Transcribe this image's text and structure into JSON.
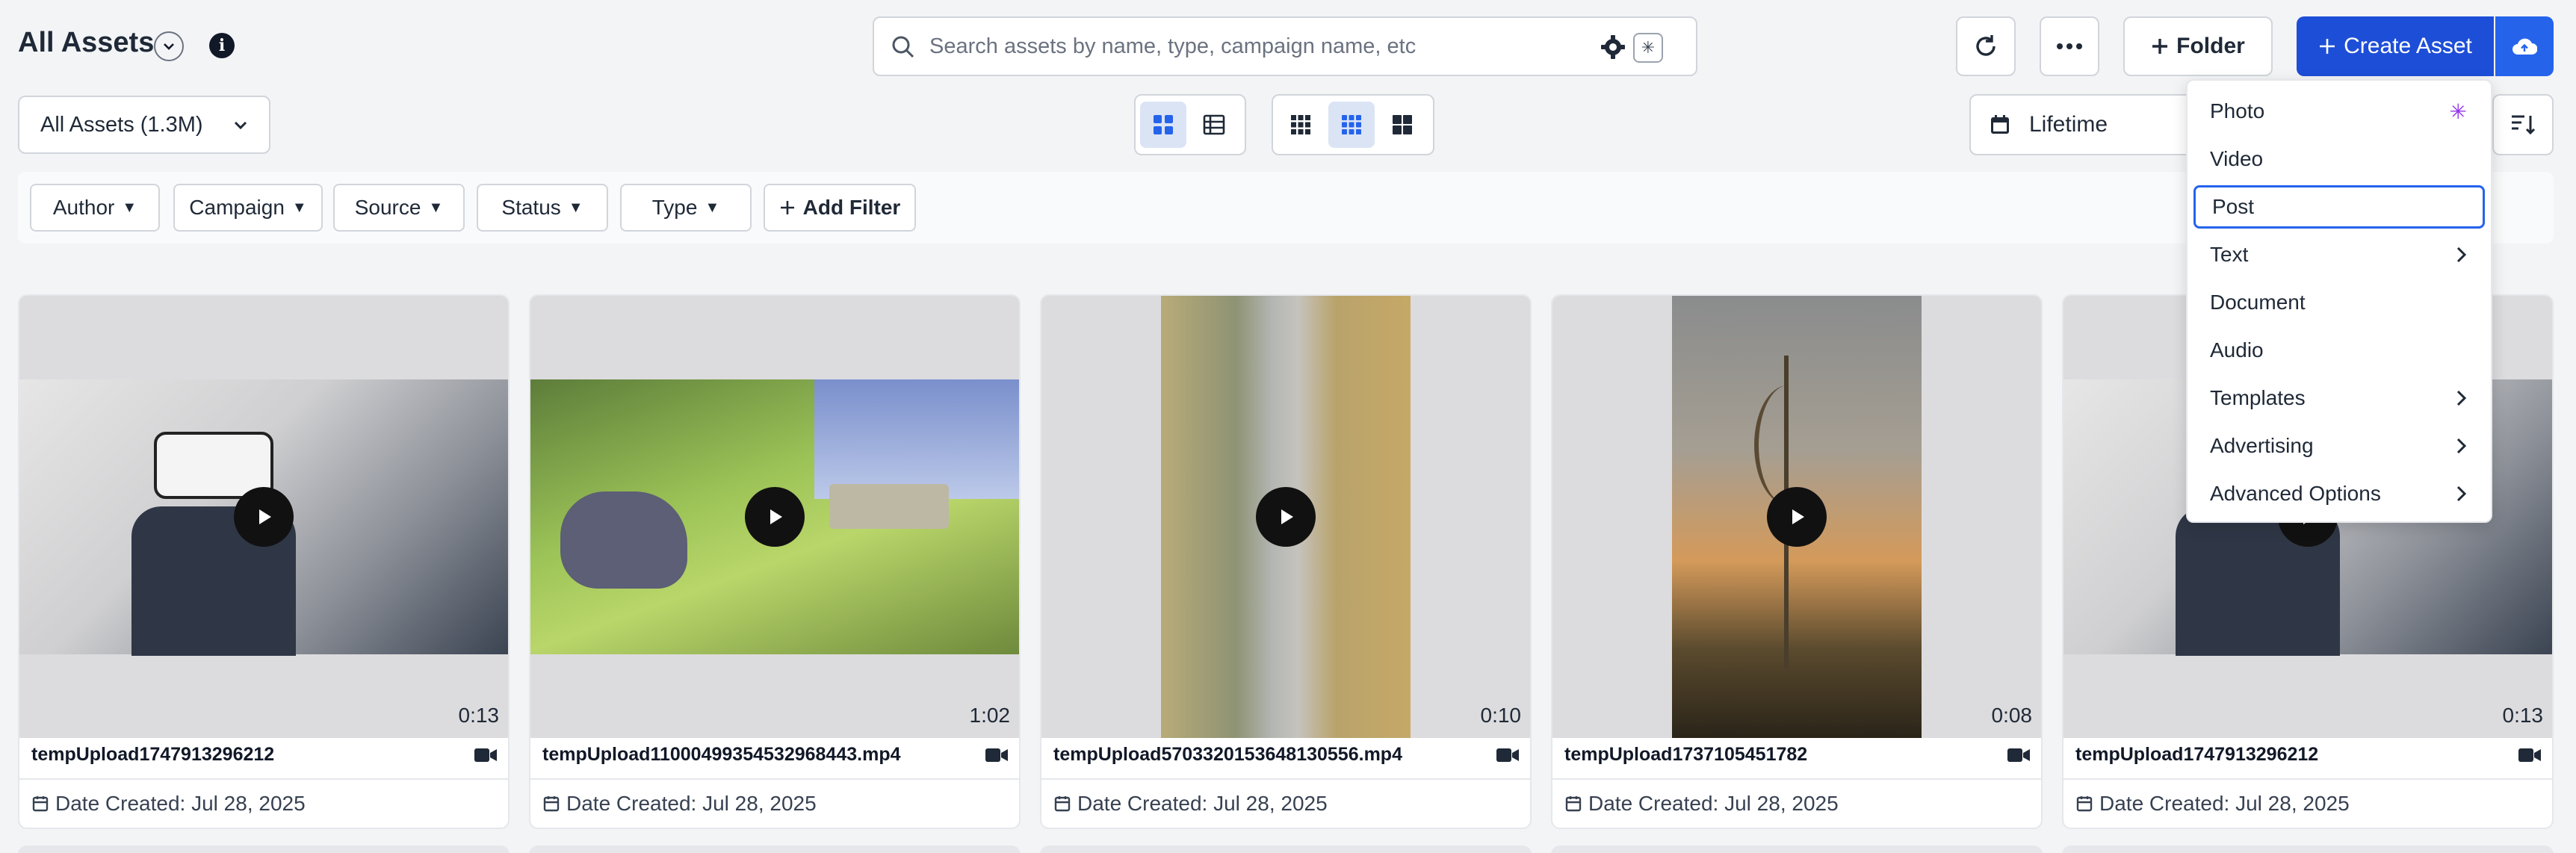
{
  "header": {
    "title": "All Assets",
    "search_placeholder": "Search assets by name, type, campaign name, etc",
    "folder_label": "Folder",
    "create_label": "Create Asset"
  },
  "toolbar": {
    "assets_dropdown": "All Assets (1.3M)",
    "date_range": "Lifetime"
  },
  "filters": [
    "Author",
    "Campaign",
    "Source",
    "Status",
    "Type"
  ],
  "add_filter_label": "Add Filter",
  "create_menu": [
    {
      "label": "Photo",
      "badge": "sparkle"
    },
    {
      "label": "Video"
    },
    {
      "label": "Post",
      "selected": true
    },
    {
      "label": "Text",
      "submenu": true
    },
    {
      "label": "Document"
    },
    {
      "label": "Audio"
    },
    {
      "label": "Templates",
      "submenu": true
    },
    {
      "label": "Advertising",
      "submenu": true
    },
    {
      "label": "Advanced Options",
      "submenu": true
    }
  ],
  "assets": [
    {
      "name": "tempUpload1747913296212",
      "duration": "0:13",
      "date": "Date Created: Jul 28, 2025",
      "type": "video"
    },
    {
      "name": "tempUpload11000499354532968443.mp4",
      "duration": "1:02",
      "date": "Date Created: Jul 28, 2025",
      "type": "video"
    },
    {
      "name": "tempUpload5703320153648130556.mp4",
      "duration": "0:10",
      "date": "Date Created: Jul 28, 2025",
      "type": "video"
    },
    {
      "name": "tempUpload1737105451782",
      "duration": "0:08",
      "date": "Date Created: Jul 28, 2025",
      "type": "video"
    },
    {
      "name": "tempUpload1747913296212",
      "duration": "0:13",
      "date": "Date Created: Jul 28, 2025",
      "type": "video"
    }
  ],
  "colors": {
    "primary": "#1d4ed8",
    "accent": "#2563eb",
    "sparkle": "#9333ea"
  }
}
